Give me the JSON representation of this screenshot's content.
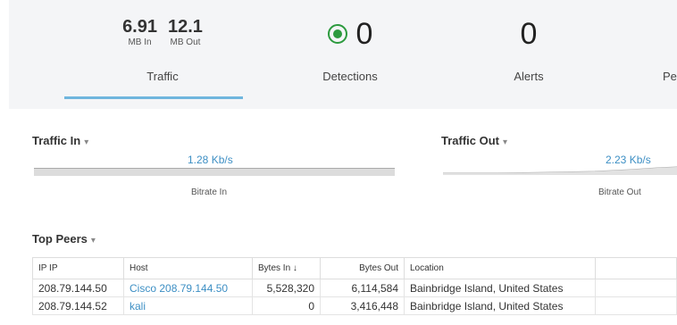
{
  "summary": {
    "traffic": {
      "in_value": "6.91",
      "in_unit": "MB In",
      "out_value": "12.1",
      "out_unit": "MB Out",
      "label": "Traffic"
    },
    "detections": {
      "value": "0",
      "label": "Detections"
    },
    "alerts": {
      "value": "0",
      "label": "Alerts"
    },
    "peers": {
      "label": "Pe"
    }
  },
  "traffic_in": {
    "title": "Traffic In",
    "caret": "▾",
    "rate": "1.28 Kb/s",
    "metric_label": "Bitrate In"
  },
  "traffic_out": {
    "title": "Traffic Out",
    "caret": "▾",
    "rate": "2.23 Kb/s",
    "metric_label": "Bitrate Out"
  },
  "top_peers": {
    "title": "Top Peers",
    "caret": "▾",
    "columns": {
      "ip": "IP IP",
      "host": "Host",
      "bytes_in": "Bytes In ↓",
      "bytes_out": "Bytes Out",
      "location": "Location"
    },
    "rows": [
      {
        "ip": "208.79.144.50",
        "host": "Cisco 208.79.144.50",
        "bytes_in": "5,528,320",
        "bytes_out": "6,114,584",
        "location": "Bainbridge Island, United States"
      },
      {
        "ip": "208.79.144.52",
        "host": "kali",
        "bytes_in": "0",
        "bytes_out": "3,416,448",
        "location": "Bainbridge Island, United States"
      }
    ]
  },
  "colors": {
    "accent": "#3d8fc4",
    "detections_green": "#2c9a3e",
    "summary_bg": "#f4f5f7"
  }
}
